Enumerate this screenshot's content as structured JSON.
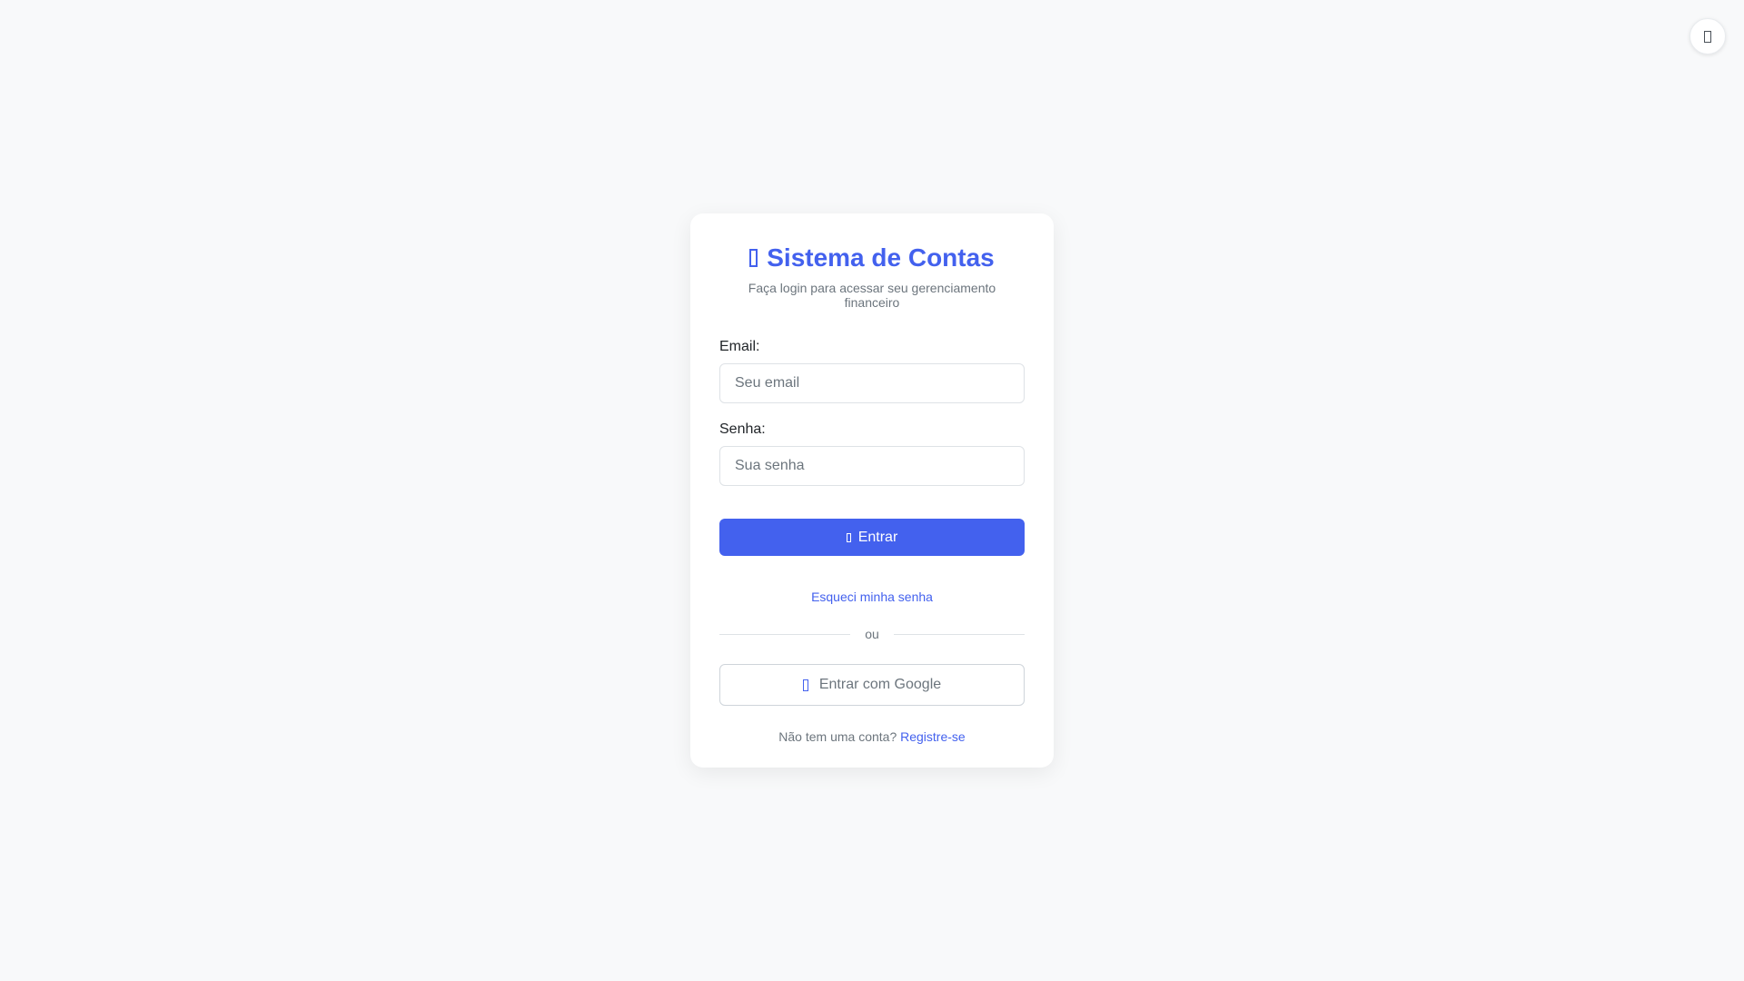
{
  "header": {
    "title": "Sistema de Contas",
    "subtitle": "Faça login para acessar seu gerenciamento financeiro"
  },
  "form": {
    "email_label": "Email:",
    "email_placeholder": "Seu email",
    "email_value": "",
    "password_label": "Senha:",
    "password_placeholder": "Sua senha",
    "password_value": "",
    "submit_label": "Entrar",
    "forgot_link": "Esqueci minha senha",
    "divider_text": "ou",
    "google_label": "Entrar com Google"
  },
  "footer": {
    "prompt": "Não tem uma conta?",
    "register_link": "Registre-se"
  },
  "icons": {
    "theme_toggle": "moon-icon",
    "title": "wallet-icon",
    "submit": "sign-in-icon",
    "google": "google-icon"
  },
  "colors": {
    "accent": "#4361ee",
    "background": "#f8f9fa",
    "muted_text": "#6c757d"
  }
}
